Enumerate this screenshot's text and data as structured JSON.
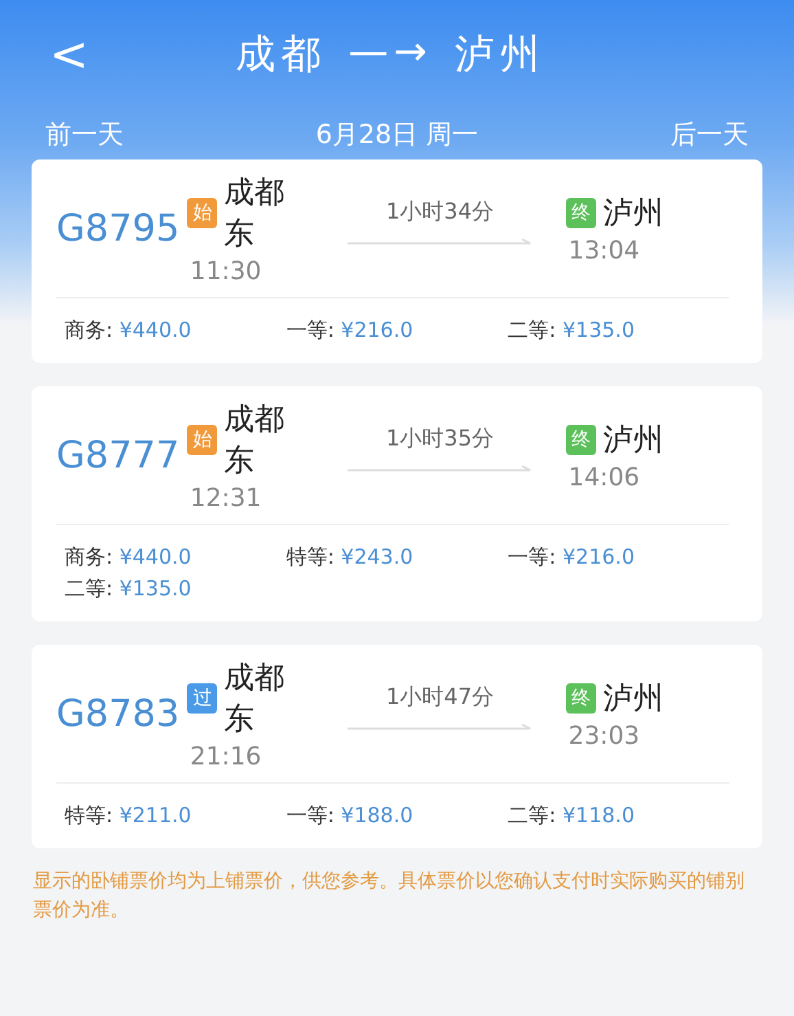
{
  "header": {
    "back": "<",
    "from": "成都",
    "arrow": "—→",
    "to": "泸州"
  },
  "date_bar": {
    "prev": "前一天",
    "date": "6月28日 周一",
    "next": "后一天"
  },
  "trains": [
    {
      "number": "G8795",
      "depart": {
        "badge": "始",
        "color": "#f09a3c",
        "station": "成都东",
        "time": "11:30"
      },
      "duration": "1小时34分",
      "arrive": {
        "badge": "终",
        "color": "#5cc15a",
        "station": "泸州",
        "time": "13:04"
      },
      "prices": [
        {
          "class": "商务:",
          "price": "¥440.0"
        },
        {
          "class": "一等:",
          "price": "¥216.0"
        },
        {
          "class": "二等:",
          "price": "¥135.0"
        }
      ]
    },
    {
      "number": "G8777",
      "depart": {
        "badge": "始",
        "color": "#f09a3c",
        "station": "成都东",
        "time": "12:31"
      },
      "duration": "1小时35分",
      "arrive": {
        "badge": "终",
        "color": "#5cc15a",
        "station": "泸州",
        "time": "14:06"
      },
      "prices": [
        {
          "class": "商务:",
          "price": "¥440.0"
        },
        {
          "class": "特等:",
          "price": "¥243.0"
        },
        {
          "class": "一等:",
          "price": "¥216.0"
        },
        {
          "class": "二等:",
          "price": "¥135.0"
        }
      ]
    },
    {
      "number": "G8783",
      "depart": {
        "badge": "过",
        "color": "#4a9ae8",
        "station": "成都东",
        "time": "21:16"
      },
      "duration": "1小时47分",
      "arrive": {
        "badge": "终",
        "color": "#5cc15a",
        "station": "泸州",
        "time": "23:03"
      },
      "prices": [
        {
          "class": "特等:",
          "price": "¥211.0"
        },
        {
          "class": "一等:",
          "price": "¥188.0"
        },
        {
          "class": "二等:",
          "price": "¥118.0"
        }
      ]
    }
  ],
  "note": "显示的卧铺票价均为上铺票价，供您参考。具体票价以您确认支付时实际购买的铺别票价为准。"
}
